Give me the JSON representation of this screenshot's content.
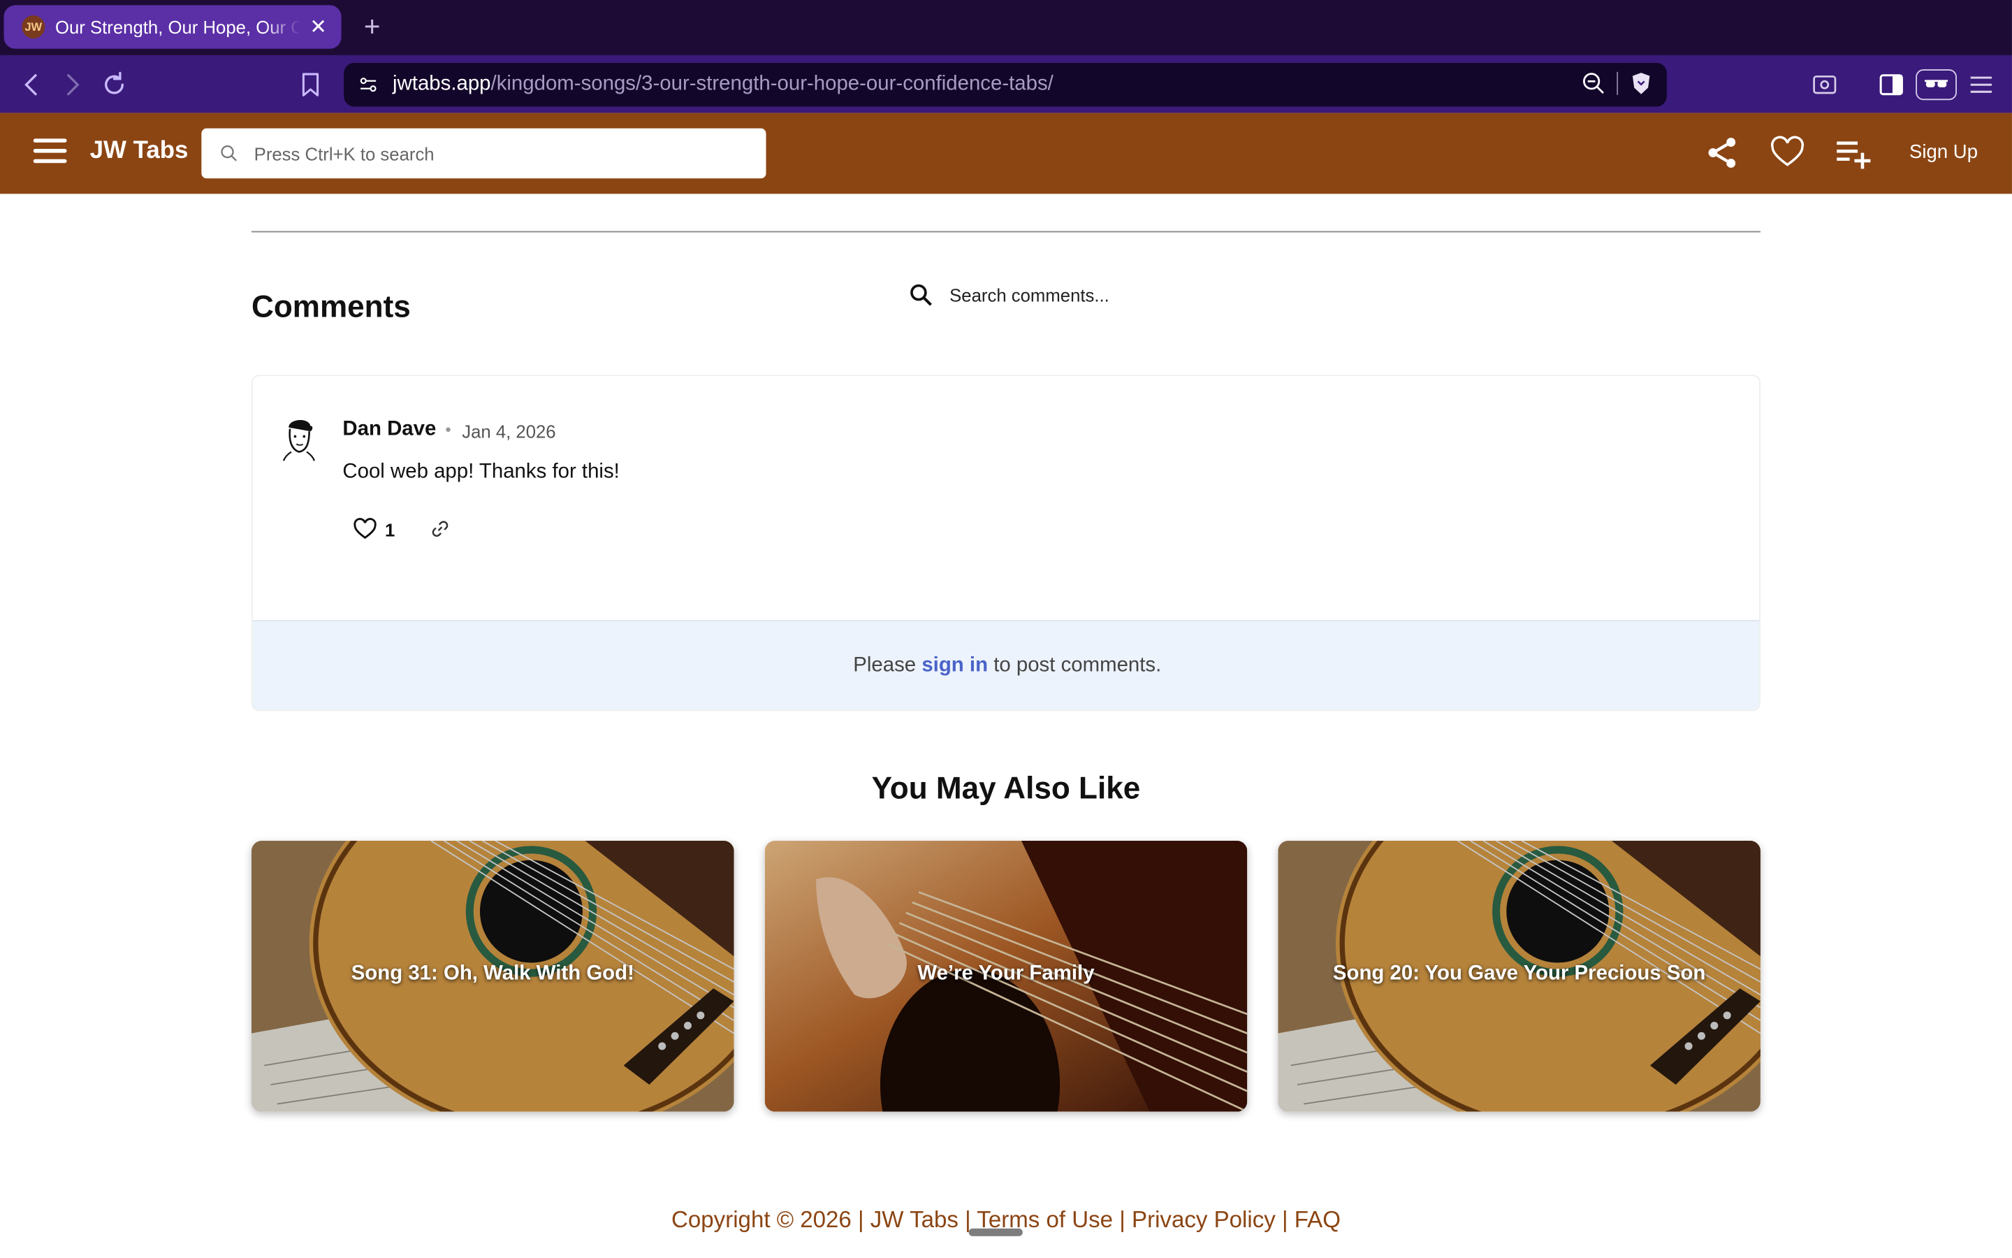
{
  "browser": {
    "tab_title": "Our Strength, Our Hope, Our Confidence",
    "favicon_text": "JW",
    "new_tab_label": "+",
    "close_label": "✕",
    "url_host": "jwtabs.app",
    "url_path": "/kingdom-songs/3-our-strength-our-hope-our-confidence-tabs/"
  },
  "header": {
    "brand": "JW Tabs",
    "search_placeholder": "Press Ctrl+K to search",
    "signup_label": "Sign Up"
  },
  "comments": {
    "title": "Comments",
    "search_placeholder": "Search comments...",
    "items": [
      {
        "author": "Dan Dave",
        "separator": "•",
        "date": "Jan 4, 2026",
        "text": "Cool web app! Thanks for this!",
        "likes": "1"
      }
    ],
    "signin_prefix": "Please ",
    "signin_link": "sign in",
    "signin_suffix": " to post comments."
  },
  "recommendations": {
    "title": "You May Also Like",
    "cards": [
      {
        "title": "Song 31: Oh, Walk With God!"
      },
      {
        "title": "We’re Your Family"
      },
      {
        "title": "Song 20: You Gave Your Precious Son"
      }
    ]
  },
  "footer": {
    "copyright": "Copyright © 2026",
    "sep": " | ",
    "brand": "JW Tabs",
    "terms": "Terms of Use",
    "privacy": "Privacy Policy",
    "faq": "FAQ"
  },
  "colors": {
    "header_bg": "#8b4513",
    "tab_bg": "#5b2fa6",
    "toolbar_bg": "#3a1a7a",
    "link": "#4a63c9",
    "signin_bg": "#edf3fc"
  }
}
